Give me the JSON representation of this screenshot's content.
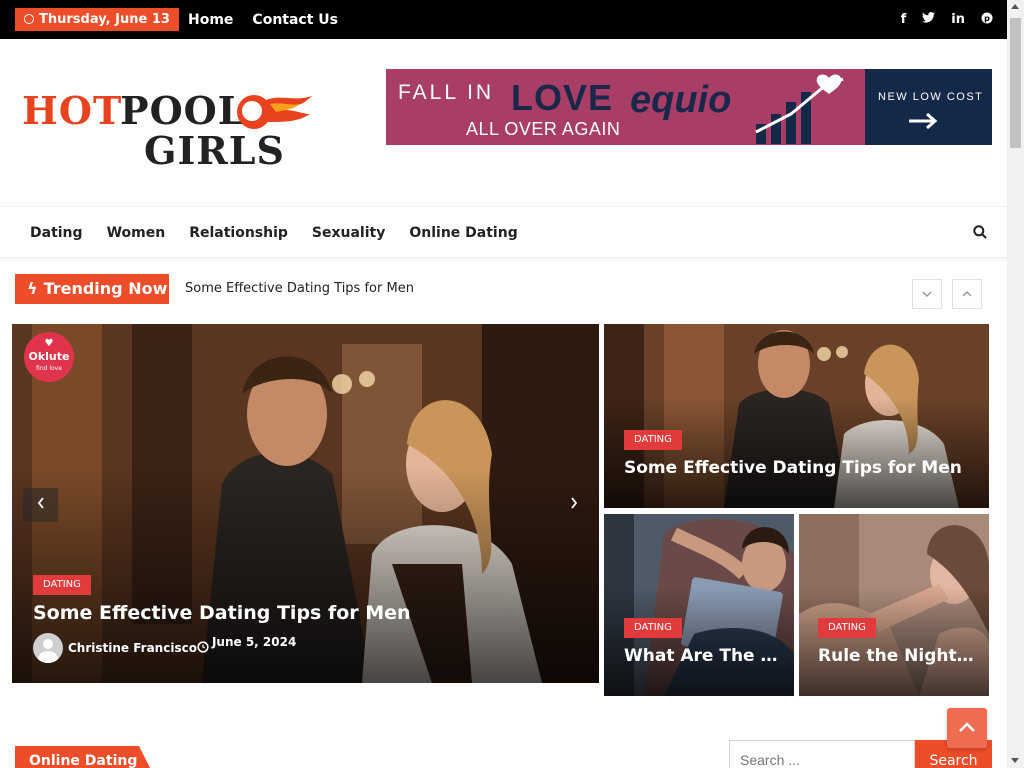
{
  "topbar": {
    "date": "Thursday, June 13",
    "nav": [
      "Home",
      "Contact Us"
    ],
    "social_icons": [
      "facebook-icon",
      "twitter-icon",
      "linkedin-icon",
      "pinterest-icon"
    ]
  },
  "logo": {
    "word1": "HOT",
    "word2": "POOL",
    "word3": "GIRLS"
  },
  "banner": {
    "line1": "FALL IN",
    "love": "LOVE",
    "line2": "ALL OVER AGAIN",
    "brand": "equio",
    "cta": "NEW LOW COST"
  },
  "mainnav": {
    "items": [
      "Dating",
      "Women",
      "Relationship",
      "Sexuality",
      "Online Dating"
    ]
  },
  "trending": {
    "label": "Trending Now",
    "headline": "Some Effective Dating Tips for Men"
  },
  "featured": {
    "main": {
      "category": "DATING",
      "title": "Some Effective Dating Tips for Men",
      "author": "Christine Francisco",
      "date": "June 5, 2024",
      "badge_name": "Oklute",
      "badge_tag": "find love"
    },
    "side_top": {
      "category": "DATING",
      "title": "Some Effective Dating Tips for Men"
    },
    "side_left": {
      "category": "DATING",
      "title": "What Are The D..."
    },
    "side_right": {
      "category": "DATING",
      "title": "Rule the Night: ..."
    }
  },
  "section": {
    "title": "Online Dating"
  },
  "search": {
    "placeholder": "Search ...",
    "button": "Search"
  },
  "colors": {
    "accent": "#ee4d2a",
    "category": "#e23b3b",
    "topbar": "#000000"
  }
}
